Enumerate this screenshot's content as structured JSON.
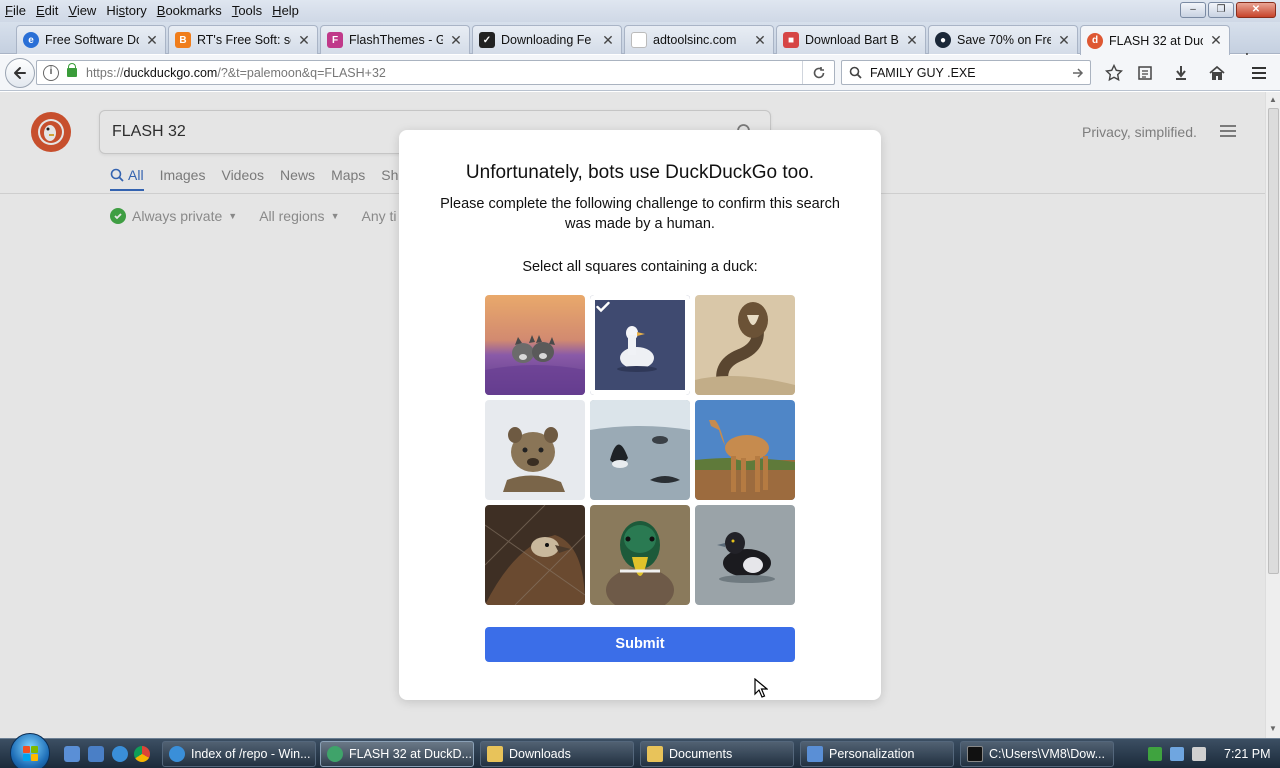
{
  "menubar": {
    "items": [
      {
        "key": "F",
        "rest": "ile"
      },
      {
        "key": "E",
        "rest": "dit"
      },
      {
        "key": "V",
        "rest": "iew"
      },
      {
        "key": "Hi",
        "rest": "story",
        "underline_second": "s"
      },
      {
        "key": "B",
        "rest": "ookmarks"
      },
      {
        "key": "T",
        "rest": "ools"
      },
      {
        "key": "H",
        "rest": "elp"
      }
    ],
    "labels": [
      "File",
      "Edit",
      "View",
      "History",
      "Bookmarks",
      "Tools",
      "Help"
    ]
  },
  "tabs": [
    {
      "title": "Free Software Do",
      "icon": "globe-icon",
      "color": "#2a6fd6"
    },
    {
      "title": "RT's Free Soft: se",
      "icon": "blogger-icon",
      "color": "#f07d1b"
    },
    {
      "title": "FlashThemes - G",
      "icon": "flashthemes-icon",
      "color": "#c0398a"
    },
    {
      "title": "Downloading Fe",
      "icon": "download-page-icon",
      "color": "#222222"
    },
    {
      "title": "adtoolsinc.com",
      "icon": "blank-page-icon",
      "color": "#ffffff"
    },
    {
      "title": "Download Bart B",
      "icon": "bart-icon",
      "color": "#d64545"
    },
    {
      "title": "Save 70% on Fre",
      "icon": "steam-icon",
      "color": "#1b2838"
    },
    {
      "title": "FLASH 32 at Duc",
      "icon": "duckduckgo-icon",
      "color": "#de5833"
    }
  ],
  "nav": {
    "url_prefix": "https://",
    "url_domain": "duckduckgo.com",
    "url_rest": "/?&t=palemoon&q=FLASH+32",
    "search_value": "FAMILY GUY .EXE"
  },
  "ddg": {
    "search_value": "FLASH 32",
    "privacy": "Privacy, simplified.",
    "tabs": [
      "All",
      "Images",
      "Videos",
      "News",
      "Maps",
      "Sh"
    ],
    "filters": [
      "Always private",
      "All regions",
      "Any ti"
    ]
  },
  "modal": {
    "title": "Unfortunately, bots use DuckDuckGo too.",
    "subtitle": "Please complete the following challenge to confirm this search was made by a human.",
    "prompt": "Select all squares containing a duck:",
    "submit": "Submit",
    "tiles": [
      {
        "subject": "wolves",
        "selected": false
      },
      {
        "subject": "white duck",
        "selected": true
      },
      {
        "subject": "cobra",
        "selected": false
      },
      {
        "subject": "hyena",
        "selected": false
      },
      {
        "subject": "orcas",
        "selected": false
      },
      {
        "subject": "camel",
        "selected": false
      },
      {
        "subject": "vulture",
        "selected": false
      },
      {
        "subject": "mallard",
        "selected": false
      },
      {
        "subject": "tufted duck",
        "selected": false
      }
    ]
  },
  "taskbar": {
    "buttons": [
      {
        "label": "Index of /repo - Win...",
        "icon": "ie-icon",
        "color": "#3a8fd9"
      },
      {
        "label": "FLASH 32 at DuckD...",
        "icon": "palemoon-icon",
        "color": "#3fa36a"
      },
      {
        "label": "Downloads",
        "icon": "folder-icon",
        "color": "#e8c35a"
      },
      {
        "label": "Documents",
        "icon": "folder-icon",
        "color": "#e8c35a"
      },
      {
        "label": "Personalization",
        "icon": "personalization-icon",
        "color": "#5a8fd6"
      },
      {
        "label": "C:\\Users\\VM8\\Dow...",
        "icon": "cmd-icon",
        "color": "#111111"
      }
    ],
    "clock": "7:21 PM"
  }
}
